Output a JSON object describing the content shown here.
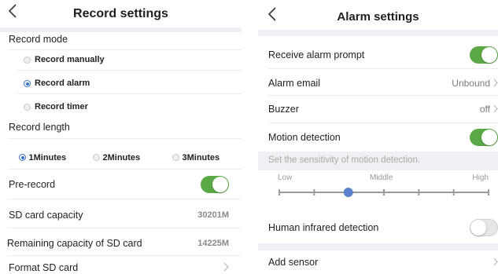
{
  "record": {
    "back_icon": "chevron-left-icon",
    "title": "Record settings",
    "mode_label": "Record mode",
    "modes": [
      {
        "label": "Record manually",
        "selected": false
      },
      {
        "label": "Record alarm",
        "selected": true
      },
      {
        "label": "Record timer",
        "selected": false
      }
    ],
    "length_label": "Record length",
    "lengths": [
      {
        "label": "1Minutes",
        "selected": true
      },
      {
        "label": "2Minutes",
        "selected": false
      },
      {
        "label": "3Minutes",
        "selected": false
      }
    ],
    "prerecord_label": "Pre-record",
    "prerecord_on": true,
    "sd_capacity_label": "SD card capacity",
    "sd_capacity_value": "30201M",
    "sd_remaining_label": "Remaining capacity of SD card",
    "sd_remaining_value": "14225M",
    "format_label": "Format SD card"
  },
  "alarm": {
    "back_icon": "chevron-left-icon",
    "title": "Alarm settings",
    "receive_prompt_label": "Receive alarm prompt",
    "receive_prompt_on": true,
    "email_label": "Alarm email",
    "email_value": "Unbound",
    "buzzer_label": "Buzzer",
    "buzzer_value": "off",
    "motion_label": "Motion detection",
    "motion_on": true,
    "sensitivity_hint": "Set the sensitivity of motion detection.",
    "sensitivity_low": "Low",
    "sensitivity_middle": "Middle",
    "sensitivity_high": "High",
    "sensitivity_fraction": 0.33,
    "infrared_label": "Human infrared detection",
    "infrared_on": false,
    "add_sensor_label": "Add sensor"
  },
  "colors": {
    "toggle_on": "#5aa946",
    "radio_selected": "#3b73c8",
    "slider_knob": "#5b82cc"
  }
}
